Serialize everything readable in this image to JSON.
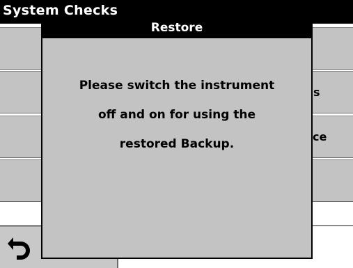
{
  "screen": {
    "title": "System Checks",
    "back_icon": "undo-arrow-icon",
    "partial_labels": [
      "s",
      "ce"
    ]
  },
  "dialog": {
    "title": "Restore",
    "message_lines": [
      "Please switch the instrument",
      "off and on for using the",
      "restored Backup."
    ]
  },
  "colors": {
    "title_bar": "#000000",
    "button_face": "#c3c3c3",
    "dialog_face": "#c3c3c3"
  }
}
